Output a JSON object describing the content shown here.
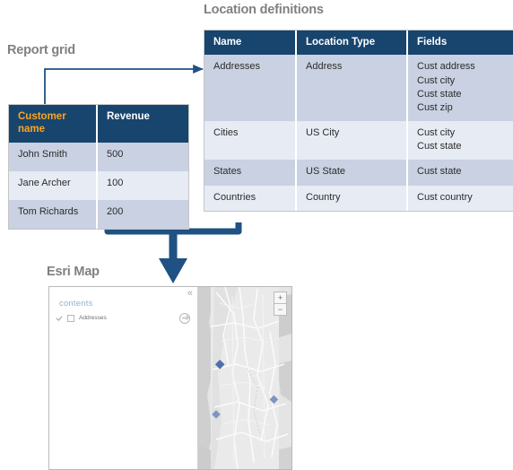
{
  "sections": {
    "report_grid_title": "Report grid",
    "location_definitions_title": "Location definitions",
    "esri_map_title": "Esri Map"
  },
  "report_grid": {
    "headers": [
      "Customer name",
      "Revenue"
    ],
    "rows": [
      {
        "customer_name": "John Smith",
        "revenue": "500"
      },
      {
        "customer_name": "Jane Archer",
        "revenue": "100"
      },
      {
        "customer_name": "Tom Richards",
        "revenue": "200"
      }
    ]
  },
  "location_definitions": {
    "headers": [
      "Name",
      "Location Type",
      "Fields"
    ],
    "rows": [
      {
        "name": "Addresses",
        "location_type": "Address",
        "fields": [
          "Cust address",
          "Cust city",
          "Cust state",
          "Cust zip"
        ]
      },
      {
        "name": "Cities",
        "location_type": "US City",
        "fields": [
          "Cust city",
          "Cust state"
        ]
      },
      {
        "name": "States",
        "location_type": "US State",
        "fields": [
          "Cust state"
        ]
      },
      {
        "name": "Countries",
        "location_type": "Country",
        "fields": [
          "Cust country"
        ]
      }
    ]
  },
  "esri_map": {
    "contents_label": "contents",
    "collapse_glyph": "«",
    "layers": [
      {
        "name": "Addresses",
        "checked": true
      }
    ],
    "zoom_in_label": "+",
    "zoom_out_label": "−",
    "marker_count": 3
  },
  "colors": {
    "header_blue": "#17456E",
    "accent_orange": "#FFA51F",
    "row_odd": "#C9D1E2",
    "row_even": "#E7EBF4",
    "title_gray": "#808080",
    "connector_blue": "#1F5183",
    "map_marker_blue": "#5878B4"
  }
}
